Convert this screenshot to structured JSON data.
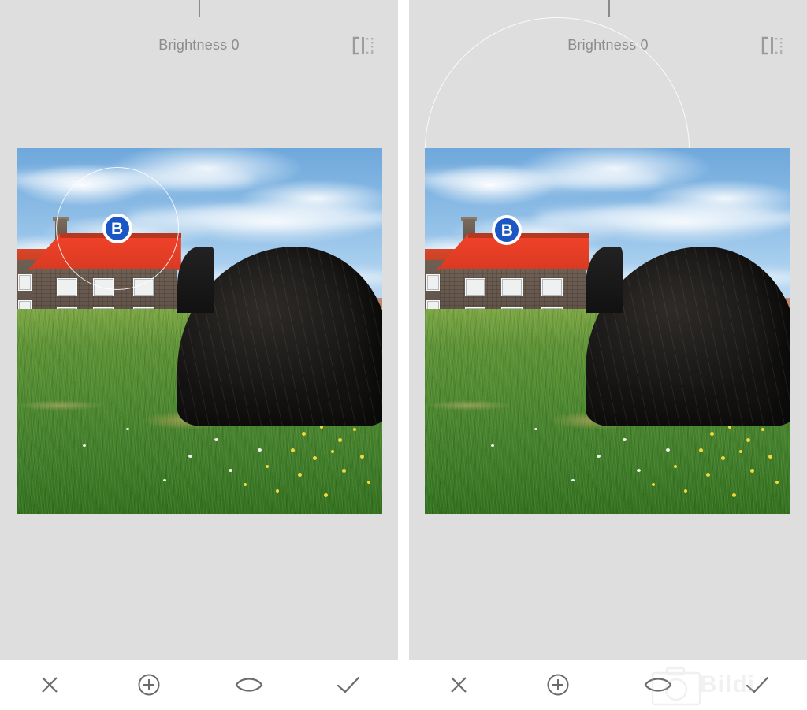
{
  "app": {
    "type": "photo-editor-selective-adjustment",
    "background_color": "#dedede",
    "toolbar_color": "#ffffff",
    "accent_color": "#1a56c4"
  },
  "panels": [
    {
      "id": "left",
      "adjustment_label": "Brightness 0",
      "adjustment_name": "Brightness",
      "adjustment_value": "0",
      "compare_icon": "compare-split-icon",
      "slider_tick": true,
      "control_point": {
        "letter": "B",
        "name": "brightness-control-point",
        "x_pct": 27.5,
        "y_pct": 22.0
      },
      "selection_ring": {
        "name": "selection-radius-ring",
        "center_x_pct": 27.5,
        "center_y_pct": 22.0,
        "radius_px": 78
      }
    },
    {
      "id": "right",
      "adjustment_label": "Brightness 0",
      "adjustment_name": "Brightness",
      "adjustment_value": "0",
      "compare_icon": "compare-split-icon",
      "slider_tick": true,
      "control_point": {
        "letter": "B",
        "name": "brightness-control-point",
        "x_pct": 22.5,
        "y_pct": 22.5
      },
      "selection_ring": {
        "name": "selection-radius-ring",
        "center_x_pct": 22.5,
        "center_y_pct": 22.5,
        "radius_px": 168
      }
    }
  ],
  "toolbar": {
    "buttons": [
      {
        "name": "cancel-button",
        "icon": "close-x-icon",
        "label": "Cancel"
      },
      {
        "name": "add-point-button",
        "icon": "plus-circle-icon",
        "label": "Add control point"
      },
      {
        "name": "preview-toggle-button",
        "icon": "eye-icon",
        "label": "Preview"
      },
      {
        "name": "apply-button",
        "icon": "check-icon",
        "label": "Apply"
      }
    ]
  },
  "watermark": {
    "icon": "camera-outline-icon",
    "text": "Bildi"
  },
  "photo": {
    "description": "Red-roofed stone farmhouse beside an upturned black boat hull in a summer meadow",
    "sky_color": "#8dbde6",
    "roof_color": "#e8402a",
    "house_color": "#655749",
    "boat_color": "#1a1817",
    "grass_color": "#4f8a30"
  }
}
